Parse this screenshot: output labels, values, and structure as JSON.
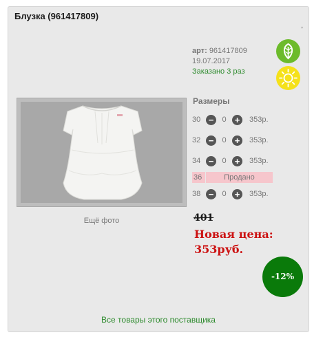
{
  "product": {
    "title": "Блузка (961417809)",
    "corner_mark": ",",
    "article_label": "арт:",
    "article_value": "961417809",
    "date": "19.07.2017",
    "ordered": "Заказано 3 раз"
  },
  "badges": [
    {
      "name": "leaf-icon",
      "color": "#6cbb2b"
    },
    {
      "name": "sun-icon",
      "color": "#f5e11a"
    }
  ],
  "photo": {
    "more_label": "Ещё фото"
  },
  "sizes": {
    "title": "Размеры",
    "rows": [
      {
        "size": "30",
        "qty": "0",
        "price": "353р."
      },
      {
        "size": "32",
        "qty": "0",
        "price": "353р."
      },
      {
        "size": "34",
        "qty": "0",
        "price": "353р."
      },
      {
        "size": "36",
        "sold_label": "Продано"
      },
      {
        "size": "38",
        "qty": "0",
        "price": "353р."
      }
    ],
    "minus": "−",
    "plus": "+"
  },
  "pricing": {
    "old_price": "401",
    "new_price_label": "Новая цена:",
    "new_price_value": "353руб.",
    "discount": "-12%"
  },
  "footer": {
    "supplier_link": "Все товары этого поставщика"
  }
}
